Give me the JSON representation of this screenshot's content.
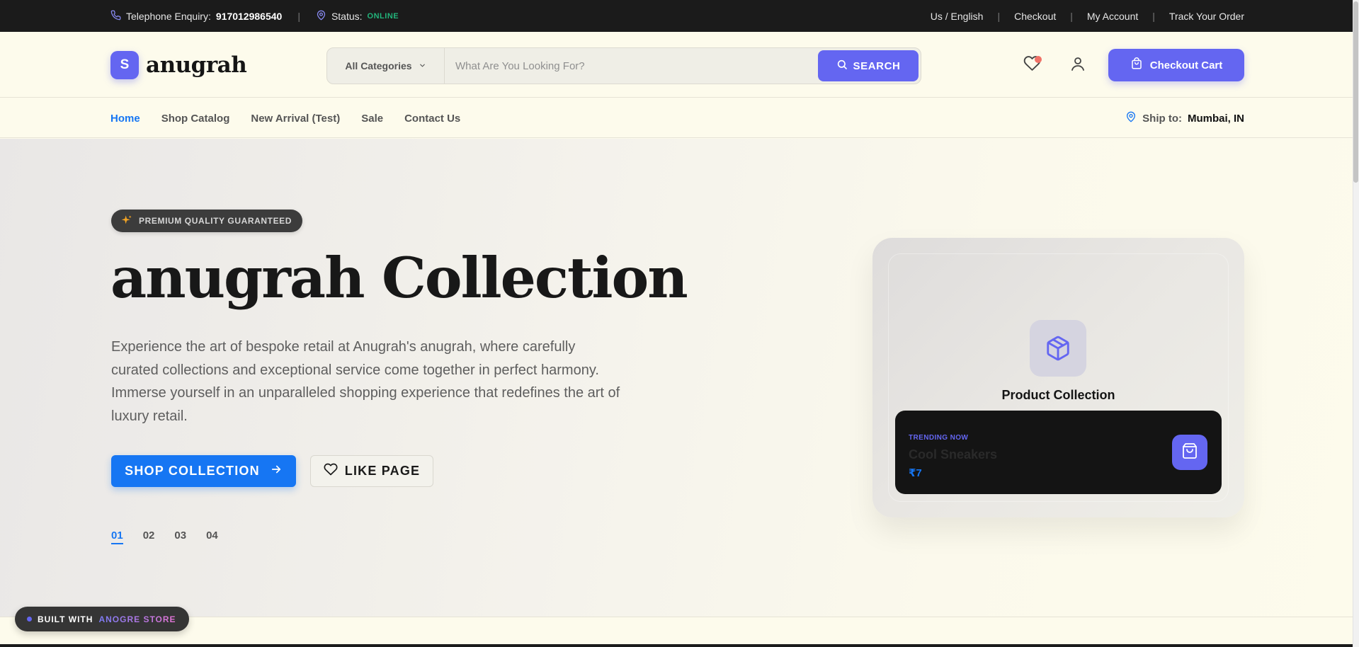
{
  "topbar": {
    "phone_label": "Telephone Enquiry:",
    "phone_number": "917012986540",
    "status_label": "Status:",
    "status_value": "ONLINE",
    "links": [
      "Us / English",
      "Checkout",
      "My Account",
      "Track Your Order"
    ]
  },
  "header": {
    "logo_letter": "S",
    "logo_text": "anugrah",
    "category_label": "All Categories",
    "search_placeholder": "What Are You Looking For?",
    "search_button": "SEARCH",
    "cart_button": "Checkout Cart"
  },
  "nav": {
    "items": [
      "Home",
      "Shop Catalog",
      "New Arrival (Test)",
      "Sale",
      "Contact Us"
    ],
    "ship_label": "Ship to:",
    "ship_value": "Mumbai, IN"
  },
  "hero": {
    "badge": "PREMIUM QUALITY GUARANTEED",
    "title": "anugrah Collection",
    "description": "Experience the art of bespoke retail at Anugrah's anugrah, where carefully curated collections and exceptional service come together in perfect harmony. Immerse yourself in an unparalleled shopping experience that redefines the art of luxury retail.",
    "primary_button": "SHOP COLLECTION",
    "secondary_button": "LIKE PAGE",
    "slides": [
      "01",
      "02",
      "03",
      "04"
    ],
    "active_slide": "01"
  },
  "card": {
    "title": "Product Collection",
    "trending_label": "TRENDING NOW",
    "trending_name": "Cool Sneakers",
    "trending_price": "₹7"
  },
  "footer_badge": {
    "prefix": "BUILT WITH",
    "brand": "ANOGRE STORE"
  },
  "colors": {
    "accent_purple": "#6466f1",
    "accent_blue": "#1676f3",
    "status_green": "#22b37a",
    "topbar_bg": "#1b1b1b",
    "page_bg": "#fdfbec"
  },
  "icons": [
    "phone-icon",
    "location-pin-icon",
    "chevron-down-icon",
    "search-icon",
    "heart-icon",
    "user-icon",
    "shopping-bag-icon",
    "sparkle-icon",
    "arrow-right-icon",
    "box-icon"
  ]
}
